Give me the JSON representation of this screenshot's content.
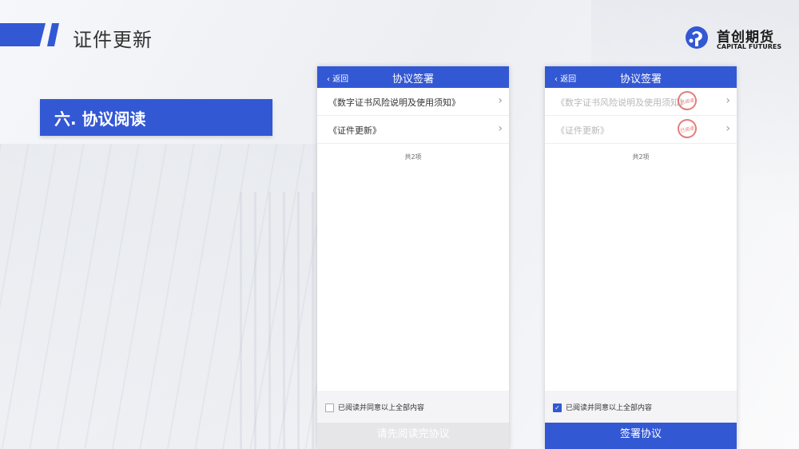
{
  "page": {
    "title": "证件更新",
    "section_heading": "六. 协议阅读"
  },
  "logo": {
    "cn": "首创期货",
    "en": "CAPITAL FUTURES"
  },
  "phones": [
    {
      "back_label": "返回",
      "nav_title": "协议签署",
      "items": [
        {
          "label": "《数字证书风险说明及使用须知》",
          "read": false
        },
        {
          "label": "《证件更新》",
          "read": false
        }
      ],
      "count": "共2项",
      "agree_text": "已阅读并同意以上全部内容",
      "agree_checked": false,
      "button_label": "请先阅读完协议",
      "button_enabled": false
    },
    {
      "back_label": "返回",
      "nav_title": "协议签署",
      "items": [
        {
          "label": "《数字证书风险说明及使用须知》",
          "read": true,
          "stamp": "已阅读"
        },
        {
          "label": "《证件更新》",
          "read": true,
          "stamp": "已阅读"
        }
      ],
      "count": "共2项",
      "agree_text": "已阅读并同意以上全部内容",
      "agree_checked": true,
      "button_label": "签署协议",
      "button_enabled": true
    }
  ],
  "colors": {
    "accent": "#3358d4",
    "stamp": "#d9534f"
  },
  "icons": {
    "back": "chevron-left-icon",
    "row": "chevron-right-icon",
    "check": "check-icon"
  }
}
